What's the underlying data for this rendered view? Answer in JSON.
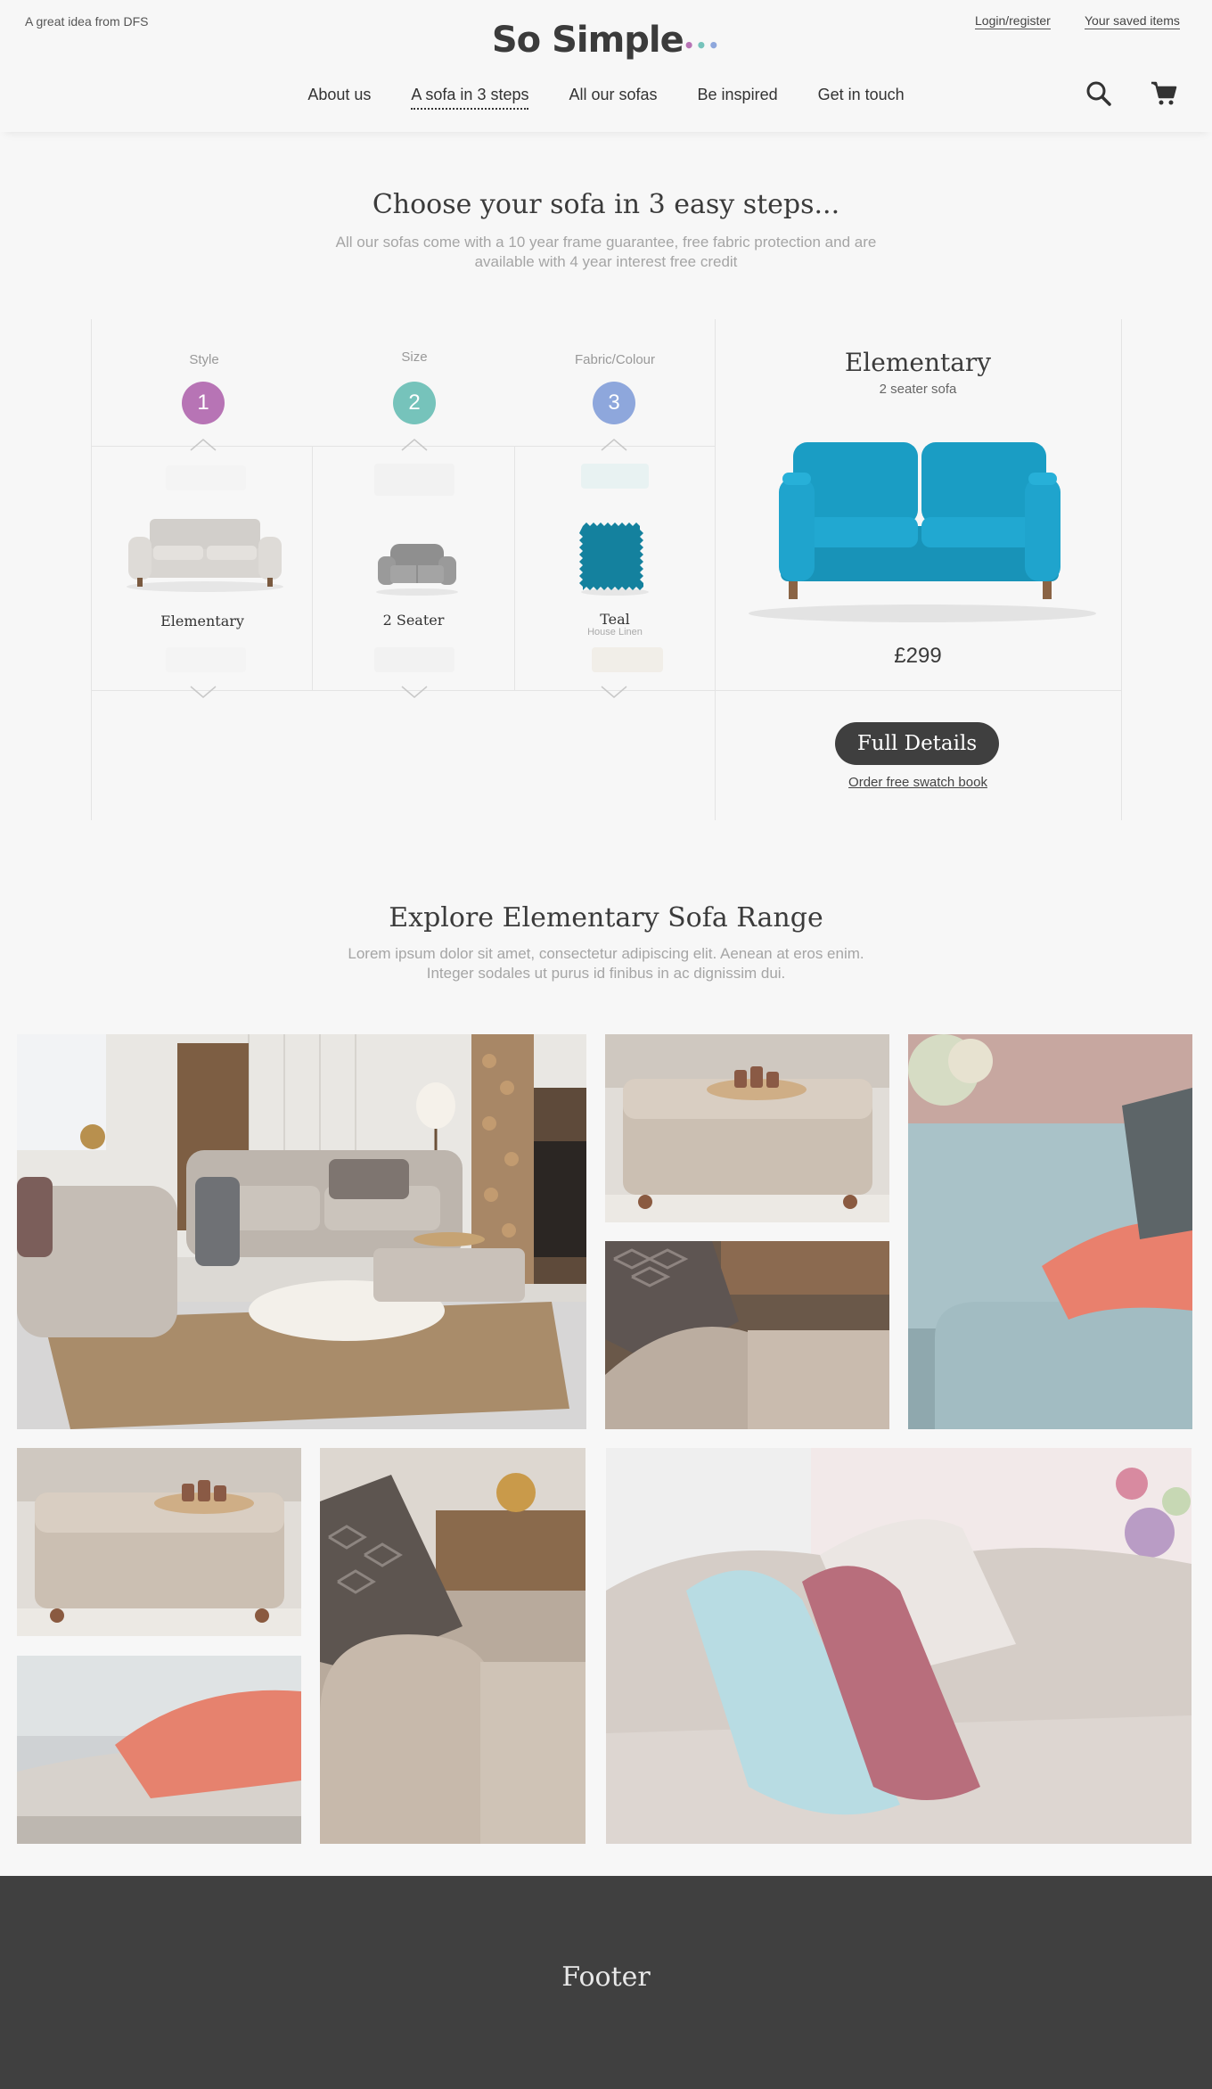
{
  "header": {
    "tagline": "A great idea from DFS",
    "logo_text": "So Simple",
    "logo_dots": [
      "•",
      "•",
      "•"
    ],
    "login_link": "Login/register",
    "saved_link": "Your saved items",
    "nav": [
      "About us",
      "A sofa in 3 steps",
      "All our sofas",
      "Be inspired",
      "Get in touch"
    ],
    "active_nav": "A sofa in 3 steps",
    "icons": [
      "search-icon",
      "cart-icon"
    ]
  },
  "hero": {
    "title": "Choose your sofa in 3 easy steps...",
    "subtitle_line1": "All our sofas come with a 10 year frame guarantee, free fabric protection and are",
    "subtitle_line2": "available with 4 year interest free credit"
  },
  "steps": [
    {
      "label": "Style",
      "number": "1",
      "color": "#b774b5",
      "selected": "Elementary",
      "selected_sub": ""
    },
    {
      "label": "Size",
      "number": "2",
      "color": "#76c3bb",
      "selected": "2 Seater",
      "selected_sub": ""
    },
    {
      "label": "Fabric/Colour",
      "number": "3",
      "color": "#8ea7dc",
      "selected": "Teal",
      "selected_sub": "House Linen"
    }
  ],
  "product": {
    "name": "Elementary",
    "subtitle": "2 seater sofa",
    "price": "£299",
    "details_button": "Full Details",
    "swatch_link": "Order free swatch book",
    "sofa_color": "#1a9dc4"
  },
  "range": {
    "title": "Explore Elementary Sofa Range",
    "text_line1": "Lorem ipsum dolor sit amet, consectetur adipiscing elit. Aenean at eros enim.",
    "text_line2": "Integer sodales ut purus id finibus in ac dignissim dui."
  },
  "footer": {
    "text": "Footer"
  }
}
